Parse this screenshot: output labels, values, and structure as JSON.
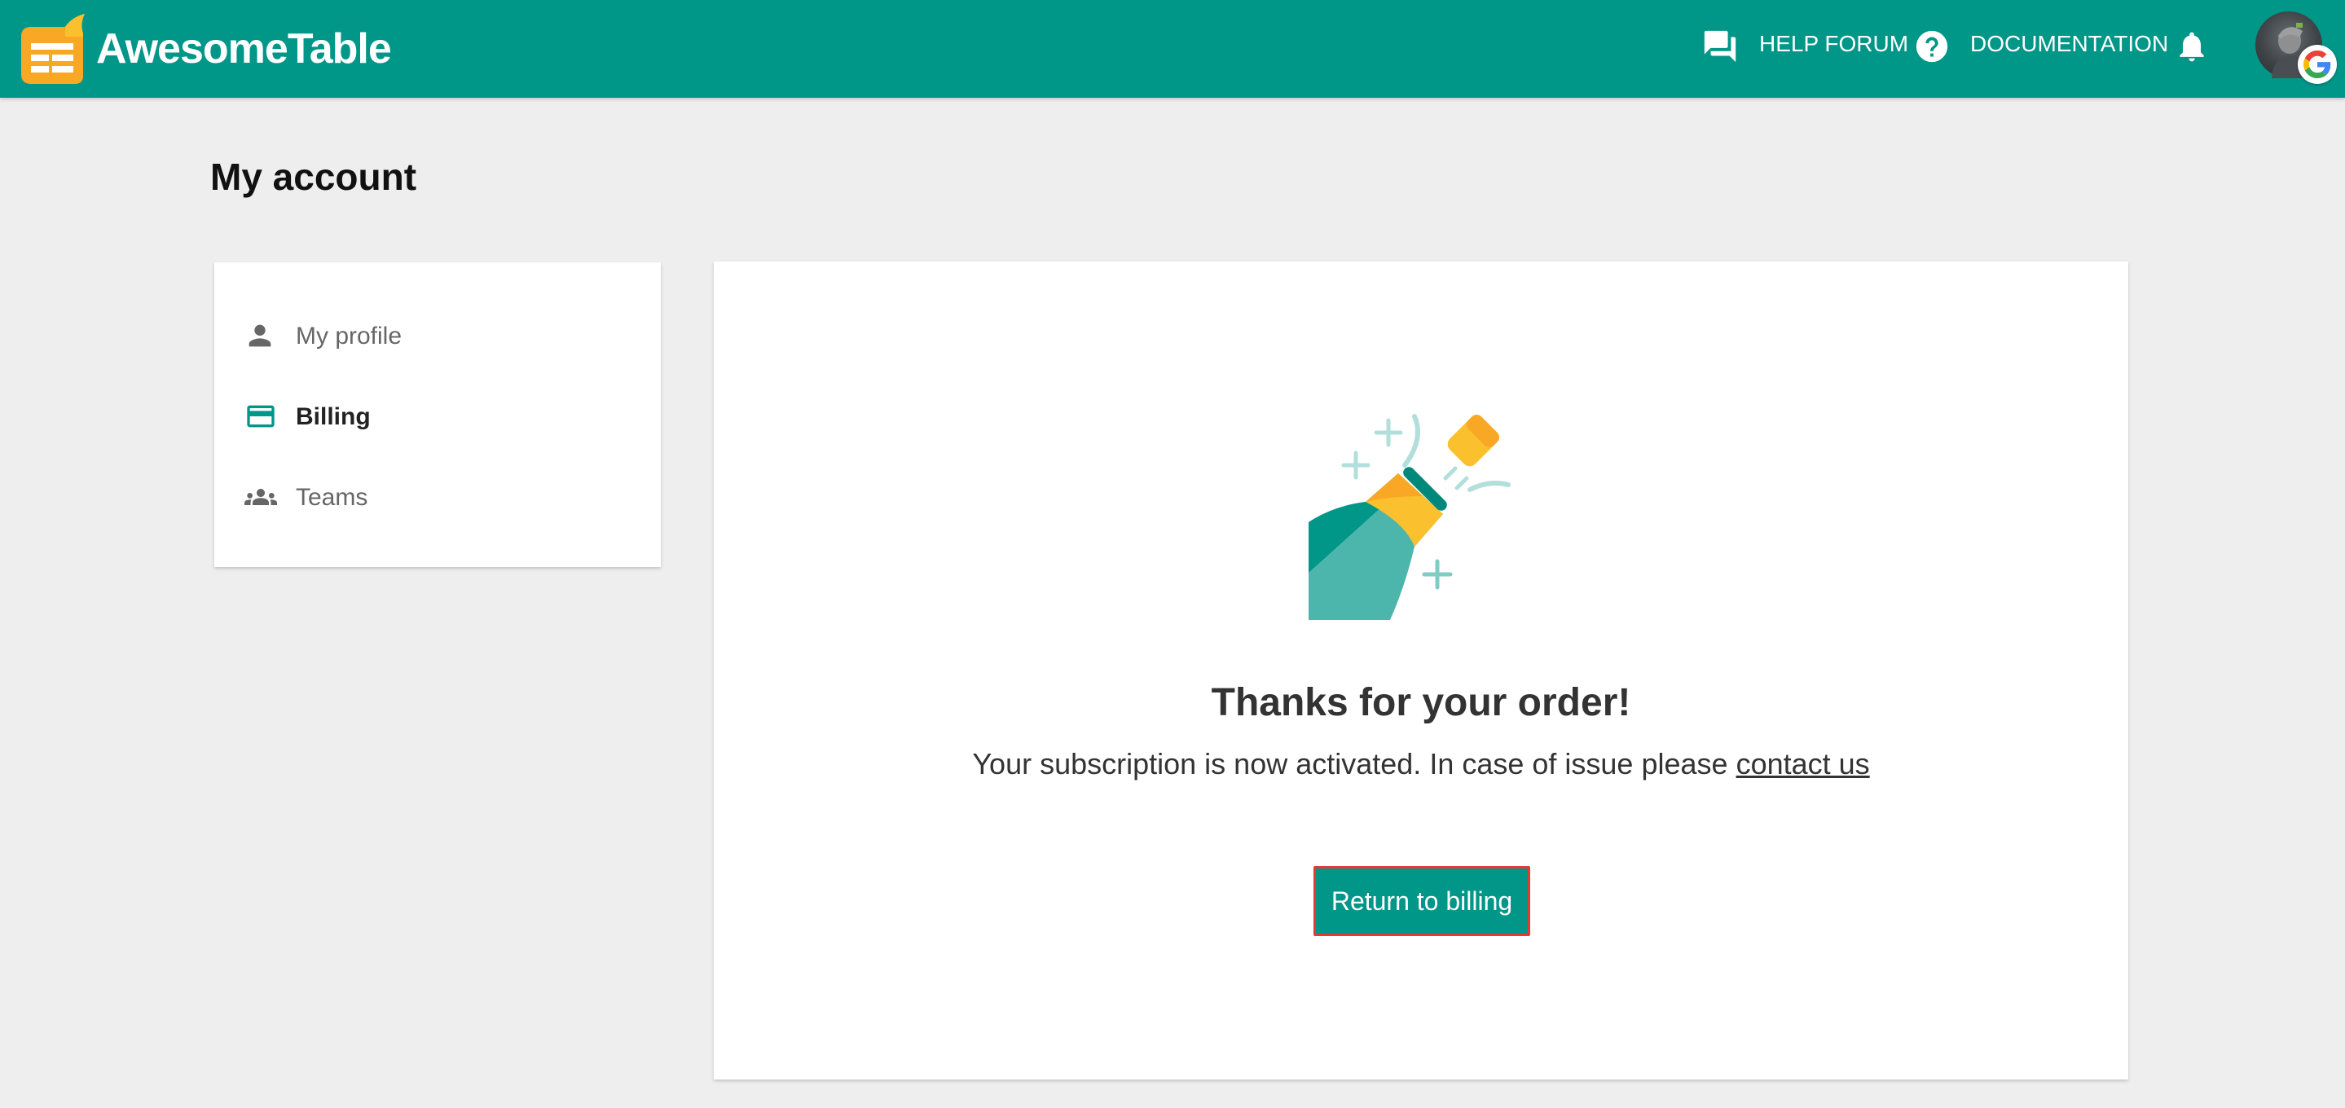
{
  "header": {
    "brand_name": "AwesomeTable",
    "help_forum": "HELP FORUM",
    "documentation": "DOCUMENTATION",
    "colors": {
      "bar": "#009688",
      "logo": "#f9a825"
    }
  },
  "page": {
    "title": "My account"
  },
  "sidebar": {
    "items": [
      {
        "label": "My profile",
        "icon": "person-icon",
        "active": false
      },
      {
        "label": "Billing",
        "icon": "credit-card-icon",
        "active": true
      },
      {
        "label": "Teams",
        "icon": "group-icon",
        "active": false
      }
    ]
  },
  "confirmation": {
    "heading": "Thanks for your order!",
    "message": "Your subscription is now activated. In case of issue please",
    "contact_link": "contact us",
    "button_label": "Return to billing",
    "illustration": "champagne-bottle-icon",
    "accent": "#009688"
  }
}
